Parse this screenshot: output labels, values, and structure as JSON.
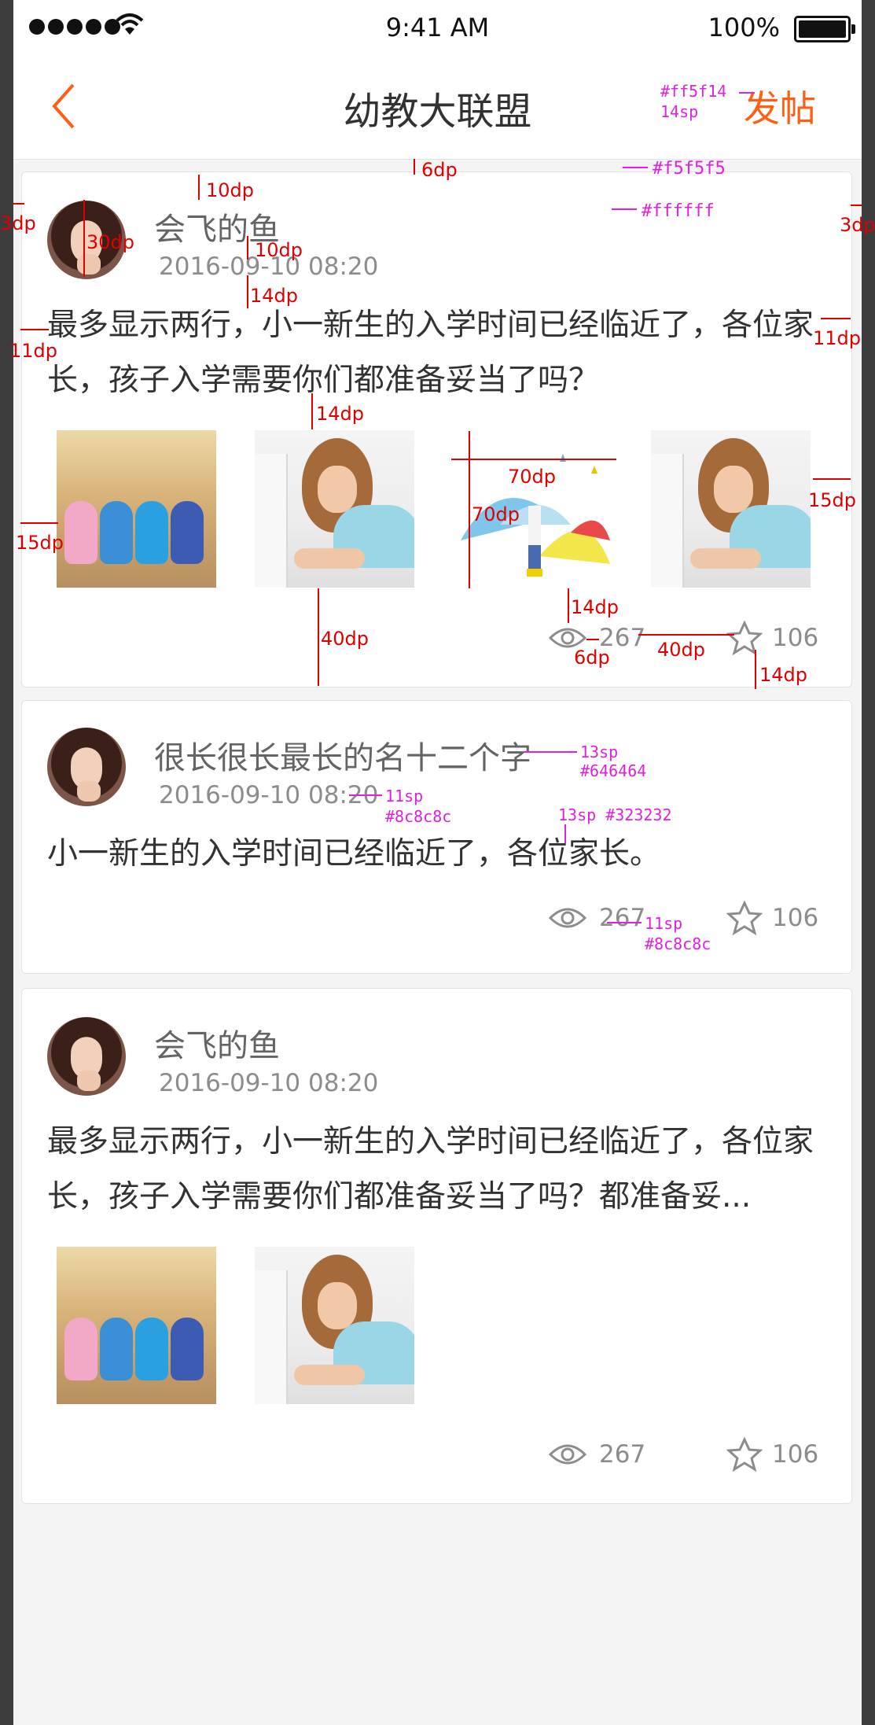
{
  "status_bar": {
    "time": "9:41 AM",
    "battery": "100%"
  },
  "nav": {
    "title": "幼教大联盟",
    "post_label": "发帖"
  },
  "posts": [
    {
      "author": "会飞的鱼",
      "time": "2016-09-10  08:20",
      "content": "最多显示两行，小一新生的入学时间已经临近了，各位家长，孩子入学需要你们都准备妥当了吗？",
      "views": "267",
      "likes": "106"
    },
    {
      "author": "很长很长最长的名十二个字",
      "time": "2016-09-10  08:20",
      "content": "小一新生的入学时间已经临近了，各位家长。",
      "views": "267",
      "likes": "106"
    },
    {
      "author": "会飞的鱼",
      "time": "2016-09-10  08:20",
      "content": "最多显示两行，小一新生的入学时间已经临近了，各位家长，孩子入学需要你们都准备妥当了吗？都准备妥...",
      "views": "267",
      "likes": "106"
    }
  ],
  "annotations": {
    "accent_color": "#ff5f14",
    "accent_size": "14sp",
    "bg_color": "#f5f5f5",
    "card_color": "#ffffff",
    "d3": "3dp",
    "d6": "6dp",
    "d10": "10dp",
    "d11": "11dp",
    "d14": "14dp",
    "d15": "15dp",
    "d30": "30dp",
    "d40": "40dp",
    "d70": "70dp",
    "name_size": "13sp",
    "name_color": "#646464",
    "time_size": "11sp",
    "time_color": "#8c8c8c",
    "content_spec": "13sp  #323232",
    "stat_size": "11sp",
    "stat_color": "#8c8c8c"
  }
}
